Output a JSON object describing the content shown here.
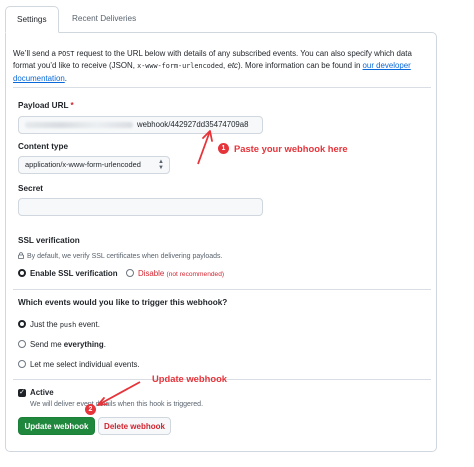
{
  "tabs": [
    {
      "label": "Settings",
      "active": true
    },
    {
      "label": "Recent Deliveries",
      "active": false
    }
  ],
  "intro": {
    "part1": "We’ll send a ",
    "method": "POST",
    "part2": " request to the URL below with details of any subscribed events. You can also specify which data format you’d like to receive (JSON, ",
    "format": "x-www-form-urlencoded",
    "part3": ", ",
    "etc": "etc",
    "part4": "). More information can be found in ",
    "link": "our developer documentation",
    "part5": "."
  },
  "payload_url": {
    "label": "Payload URL",
    "required_mark": "*",
    "value_visible": "webhook/442927dd35474709a8"
  },
  "content_type": {
    "label": "Content type",
    "value": "application/x-www-form-urlencoded"
  },
  "secret": {
    "label": "Secret",
    "value": ""
  },
  "ssl": {
    "label": "SSL verification",
    "description": "By default, we verify SSL certificates when delivering payloads.",
    "enable_label": "Enable SSL verification",
    "disable_label": "Disable",
    "disable_note": "(not recommended)",
    "selected": "enable"
  },
  "events": {
    "question": "Which events would you like to trigger this webhook?",
    "option_push_prefix": "Just the ",
    "option_push_code": "push",
    "option_push_suffix": " event.",
    "option_all_prefix": "Send me ",
    "option_all_bold": "everything",
    "option_all_suffix": ".",
    "option_individual": "Let me select individual events.",
    "selected": "push"
  },
  "active": {
    "label": "Active",
    "checked": true,
    "description": "We will deliver event details when this hook is triggered."
  },
  "buttons": {
    "update": "Update webhook",
    "delete": "Delete webhook"
  },
  "annotations": {
    "one_number": "1",
    "one_text": "Paste your webhook here",
    "two_number": "2",
    "two_text": "Update webhook",
    "color": "#e5343a"
  },
  "colors": {
    "primary_green": "#1f883d",
    "danger_red": "#d1242f",
    "link_blue": "#0969da",
    "border": "#d0d7de"
  }
}
